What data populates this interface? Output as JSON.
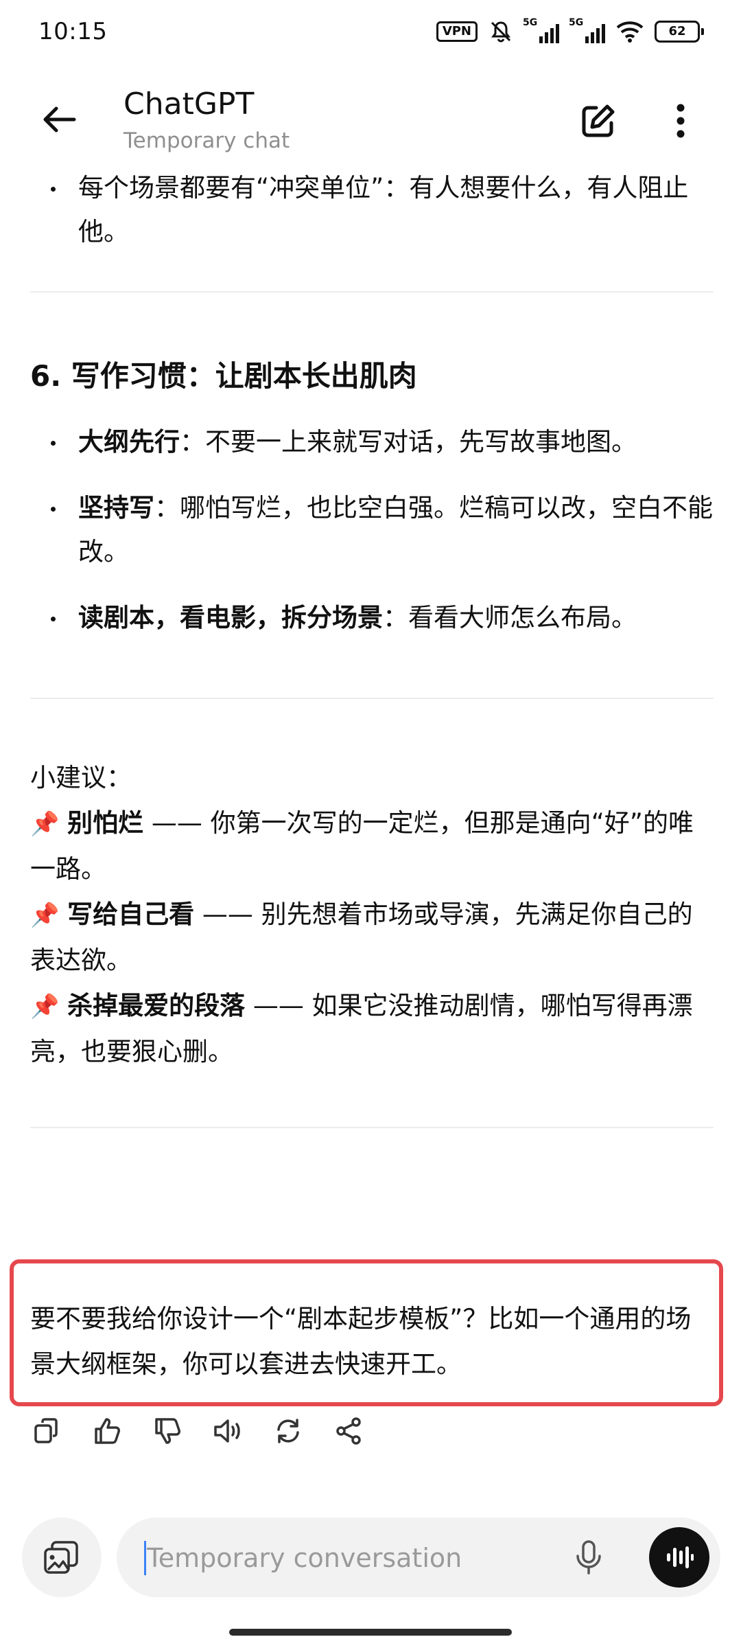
{
  "status_bar": {
    "time": "10:15",
    "vpn": "VPN",
    "sim1": "5G",
    "sim2": "5G",
    "battery": "62"
  },
  "header": {
    "title": "ChatGPT",
    "subtitle": "Temporary chat"
  },
  "message": {
    "top_bullet": "每个场景都要有“冲突单位”：有人想要什么，有人阻止他。",
    "section6": {
      "heading": "6. 写作习惯：让剧本长出肌肉",
      "bullets": [
        {
          "bold": "大纲先行",
          "text": "：不要一上来就写对话，先写故事地图。"
        },
        {
          "bold": "坚持写",
          "text": "：哪怕写烂，也比空白强。烂稿可以改，空白不能改。"
        },
        {
          "bold": "读剧本，看电影，拆分场景",
          "text": "：看看大师怎么布局。"
        }
      ]
    },
    "tips": {
      "label": "小建议：",
      "items": [
        {
          "icon": "📌",
          "bold": "别怕烂",
          "text": " —— 你第一次写的一定烂，但那是通向“好”的唯一路。"
        },
        {
          "icon": "📌",
          "bold": "写给自己看",
          "text": " —— 别先想着市场或导演，先满足你自己的表达欲。"
        },
        {
          "icon": "📌",
          "bold": "杀掉最爱的段落",
          "text": " —— 如果它没推动剧情，哪怕写得再漂亮，也要狠心删。"
        }
      ]
    },
    "closing_question": "要不要我给你设计一个“剧本起步模板”？比如一个通用的场景大纲框架，你可以套进去快速开工。"
  },
  "actions": [
    "copy-icon",
    "thumbs-up-icon",
    "thumbs-down-icon",
    "speaker-icon",
    "regenerate-icon",
    "share-icon"
  ],
  "composer": {
    "placeholder": "Temporary conversation",
    "value": ""
  },
  "colors": {
    "highlight_border": "#e5484d",
    "caret": "#3b82f6",
    "muted_text": "#8f8f8f"
  }
}
